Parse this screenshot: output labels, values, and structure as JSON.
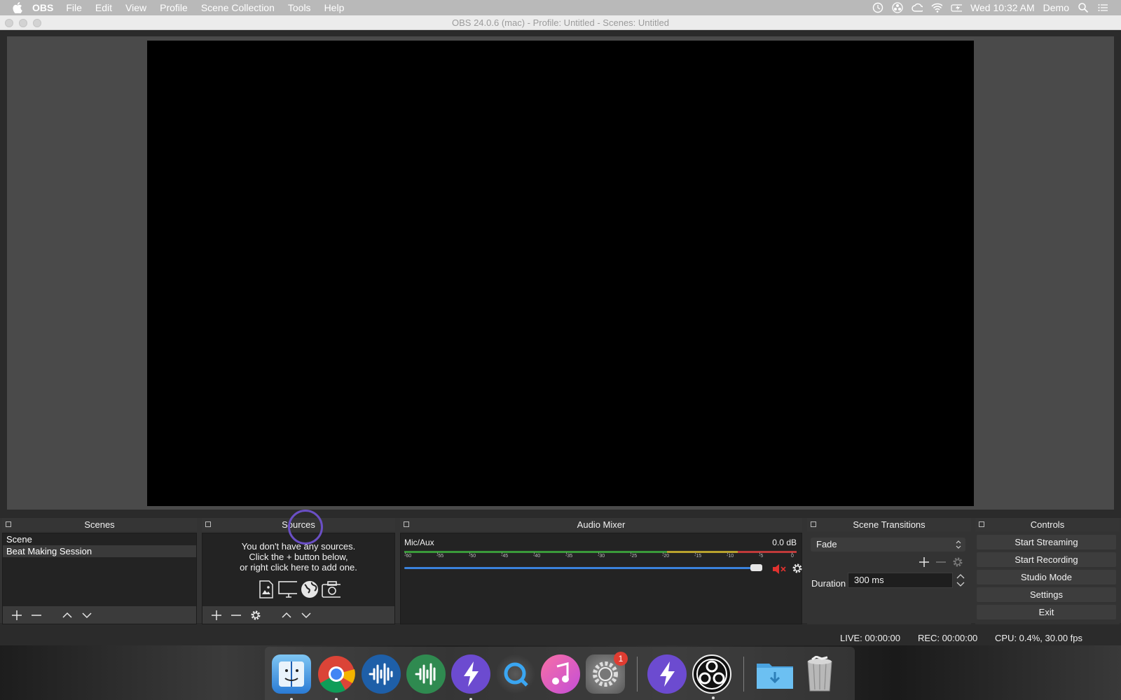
{
  "menubar": {
    "app_name": "OBS",
    "items": [
      "File",
      "Edit",
      "View",
      "Profile",
      "Scene Collection",
      "Tools",
      "Help"
    ],
    "clock": "Wed 10:32 AM",
    "user": "Demo"
  },
  "window": {
    "title": "OBS 24.0.6 (mac) - Profile: Untitled - Scenes: Untitled"
  },
  "scenes": {
    "header": "Scenes",
    "items": [
      "Scene",
      "Beat Making Session"
    ],
    "selected_index": 1
  },
  "sources": {
    "header": "Sources",
    "empty_lines": [
      "You don't have any sources.",
      "Click the + button below,",
      "or right click here to add one."
    ]
  },
  "audio_mixer": {
    "header": "Audio Mixer",
    "channel": "Mic/Aux",
    "level": "0.0 dB",
    "scale": [
      "-60",
      "-55",
      "-50",
      "-45",
      "-40",
      "-35",
      "-30",
      "-25",
      "-20",
      "-15",
      "-10",
      "-5",
      "0"
    ],
    "volume_fraction": 1.0,
    "muted": true
  },
  "transitions": {
    "header": "Scene Transitions",
    "selected": "Fade",
    "duration_label": "Duration",
    "duration_value": "300 ms"
  },
  "controls": {
    "header": "Controls",
    "buttons": [
      "Start Streaming",
      "Start Recording",
      "Studio Mode",
      "Settings",
      "Exit"
    ]
  },
  "status": {
    "live": "LIVE: 00:00:00",
    "rec": "REC: 00:00:00",
    "cpu": "CPU: 0.4%, 30.00 fps"
  },
  "dock": {
    "apps": [
      "finder",
      "chrome",
      "audio-app",
      "audio-app-green",
      "bolt-app",
      "quicktime",
      "itunes",
      "system-preferences",
      "bolt-app-2",
      "obs",
      "downloads",
      "trash"
    ],
    "system_preferences_badge": "1"
  },
  "colors": {
    "accent": "#3a82dc",
    "mute_red": "#e0322f",
    "cursor_ring": "#6a4fc5"
  }
}
